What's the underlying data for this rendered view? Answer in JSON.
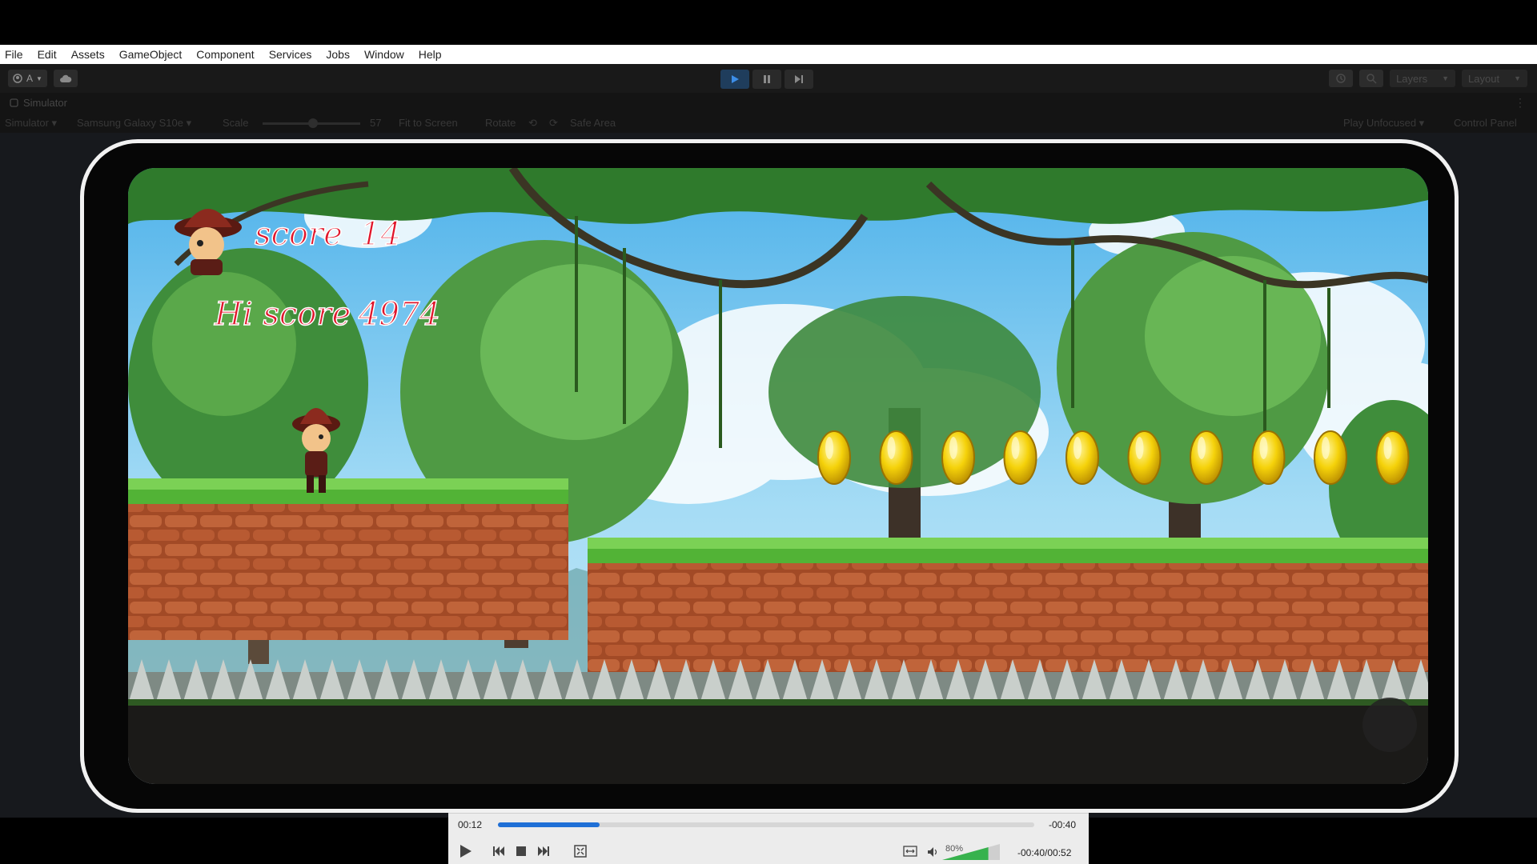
{
  "menubar": {
    "items": [
      "File",
      "Edit",
      "Assets",
      "GameObject",
      "Component",
      "Services",
      "Jobs",
      "Window",
      "Help"
    ]
  },
  "toolbar": {
    "account_label": "A",
    "cloud_icon": "cloud-icon",
    "play_icon": "play-icon",
    "pause_icon": "pause-icon",
    "step_icon": "step-icon",
    "history_icon": "history-icon",
    "search_icon": "search-icon",
    "layers_label": "Layers",
    "layout_label": "Layout"
  },
  "simulator_tab": {
    "title": "Simulator",
    "more_label": "⋮"
  },
  "simulator_bar": {
    "mode": "Simulator",
    "device": "Samsung Galaxy S10e",
    "scale_label": "Scale",
    "scale_value": "57",
    "fit_to_screen": "Fit to Screen",
    "rotate_label": "Rotate",
    "safe_area": "Safe Area",
    "play_focus": "Play Unfocused",
    "control_panel": "Control Panel"
  },
  "game": {
    "score_label": "score",
    "score_value": "14",
    "hiscore_label": "Hi score",
    "hiscore_value": "4974",
    "coin_count": 10,
    "colors": {
      "sky": "#9fd8f5",
      "grass": "#52b336",
      "brick": "#b3542c",
      "coin": "#f5d20a"
    }
  },
  "player": {
    "elapsed": "00:12",
    "remaining": "-00:40",
    "progress": 0.19,
    "volume_label": "80%",
    "volume": 0.8,
    "duration_readout": "-00:40/00:52",
    "accent": "#1f6fd6"
  }
}
